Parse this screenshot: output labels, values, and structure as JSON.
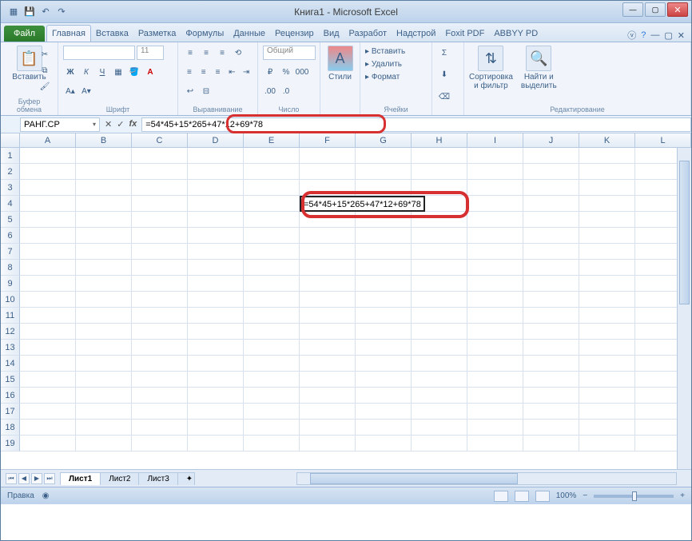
{
  "window": {
    "title": "Книга1 - Microsoft Excel"
  },
  "tabs": {
    "file": "Файл",
    "items": [
      "Главная",
      "Вставка",
      "Разметка",
      "Формулы",
      "Данные",
      "Рецензир",
      "Вид",
      "Разработ",
      "Надстрой",
      "Foxit PDF",
      "ABBYY PD"
    ],
    "active": 0
  },
  "ribbon": {
    "g1": {
      "btn": "Вставить",
      "label": "Буфер обмена"
    },
    "g2": {
      "label": "Шрифт",
      "size": "11"
    },
    "g3": {
      "label": "Выравнивание"
    },
    "g4": {
      "label": "Число",
      "format": "Общий"
    },
    "g5": {
      "btn": "Стили"
    },
    "g6": {
      "label": "Ячейки",
      "b1": "Вставить",
      "b2": "Удалить",
      "b3": "Формат"
    },
    "g7": {
      "label": "Редактирование",
      "b1": "Сортировка\nи фильтр",
      "b2": "Найти и\nвыделить"
    }
  },
  "formula_bar": {
    "name_box": "РАНГ.СР",
    "formula": "=54*45+15*265+47*12+69*78"
  },
  "columns": [
    "A",
    "B",
    "C",
    "D",
    "E",
    "F",
    "G",
    "H",
    "I",
    "J",
    "K",
    "L"
  ],
  "rows": [
    1,
    2,
    3,
    4,
    5,
    6,
    7,
    8,
    9,
    10,
    11,
    12,
    13,
    14,
    15,
    16,
    17,
    18,
    19
  ],
  "active_cell": {
    "row": 4,
    "col": 5,
    "value": "=54*45+15*265+47*12+69*78"
  },
  "sheets": {
    "items": [
      "Лист1",
      "Лист2",
      "Лист3"
    ],
    "active": 0
  },
  "status": {
    "mode": "Правка",
    "zoom": "100%"
  }
}
